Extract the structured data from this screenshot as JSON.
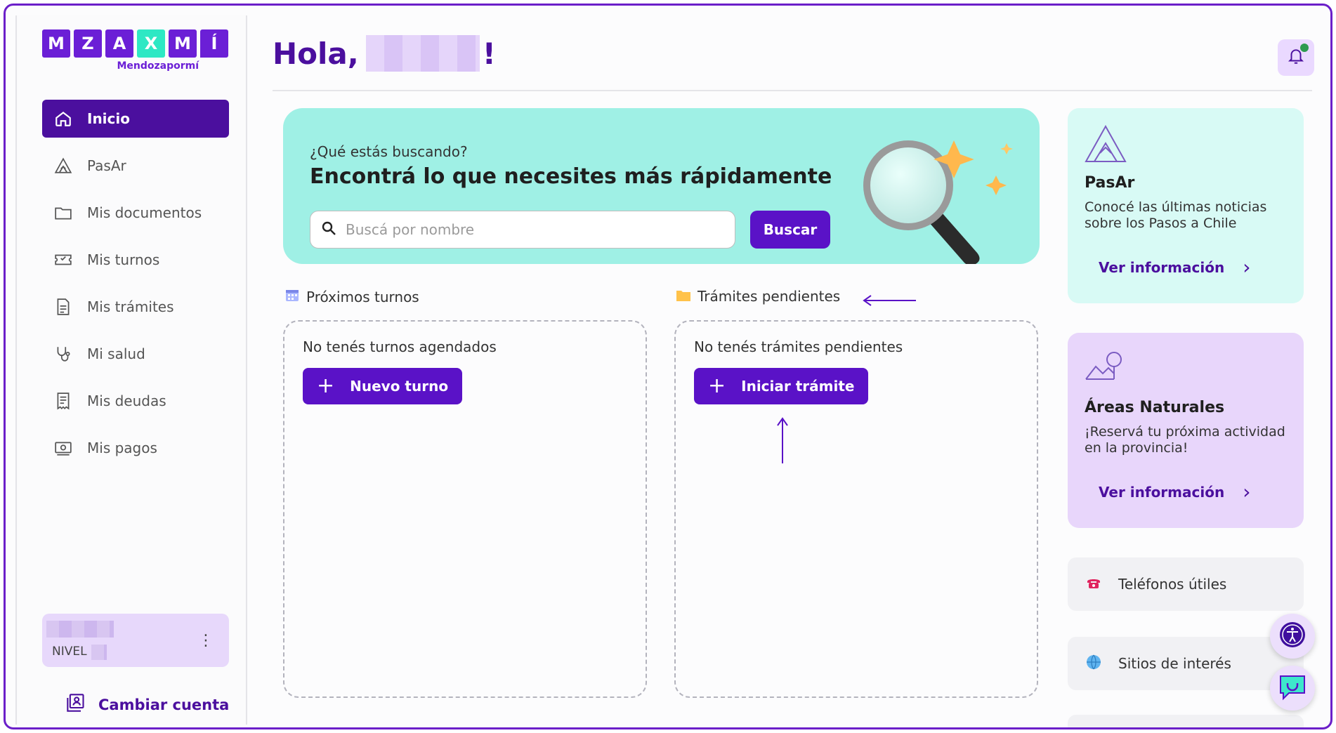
{
  "logo": {
    "letters": [
      "M",
      "Z",
      "A",
      "X",
      "M",
      "Í"
    ],
    "subtitle": "Mendozapormí"
  },
  "sidebar": {
    "items": [
      {
        "label": "Inicio",
        "icon": "home-icon",
        "active": true
      },
      {
        "label": "PasAr",
        "icon": "mountain-icon",
        "active": false
      },
      {
        "label": "Mis documentos",
        "icon": "folder-icon",
        "active": false
      },
      {
        "label": "Mis turnos",
        "icon": "ticket-icon",
        "active": false
      },
      {
        "label": "Mis trámites",
        "icon": "document-icon",
        "active": false
      },
      {
        "label": "Mi salud",
        "icon": "stethoscope-icon",
        "active": false
      },
      {
        "label": "Mis deudas",
        "icon": "receipt-icon",
        "active": false
      },
      {
        "label": "Mis pagos",
        "icon": "money-icon",
        "active": false
      }
    ],
    "user_level": "NIVEL",
    "switch_account": "Cambiar cuenta"
  },
  "header": {
    "greeting": "Hola,",
    "exclamation": "!"
  },
  "search": {
    "subtitle": "¿Qué estás buscando?",
    "title": "Encontrá lo que necesites más rápidamente",
    "placeholder": "Buscá por nombre",
    "button": "Buscar"
  },
  "turnos": {
    "label": "Próximos turnos",
    "empty": "No tenés turnos agendados",
    "button": "Nuevo turno"
  },
  "tramites": {
    "label": "Trámites pendientes",
    "empty": "No tenés trámites pendientes",
    "button": "Iniciar trámite"
  },
  "cards": {
    "pasar": {
      "title": "PasAr",
      "desc": "Conocé las últimas noticias sobre los Pasos a Chile",
      "link": "Ver información"
    },
    "areas": {
      "title": "Áreas Naturales",
      "desc": "¡Reservá tu próxima actividad en la provincia!",
      "link": "Ver información"
    }
  },
  "utilities": {
    "phones": "Teléfonos útiles",
    "sites": "Sitios de interés"
  },
  "colors": {
    "brand": "#4b0f9e",
    "button": "#5a12c7",
    "hero": "#9ff0e5",
    "accent_teal": "#2ee8c4",
    "notification": "#2e9b4f"
  }
}
